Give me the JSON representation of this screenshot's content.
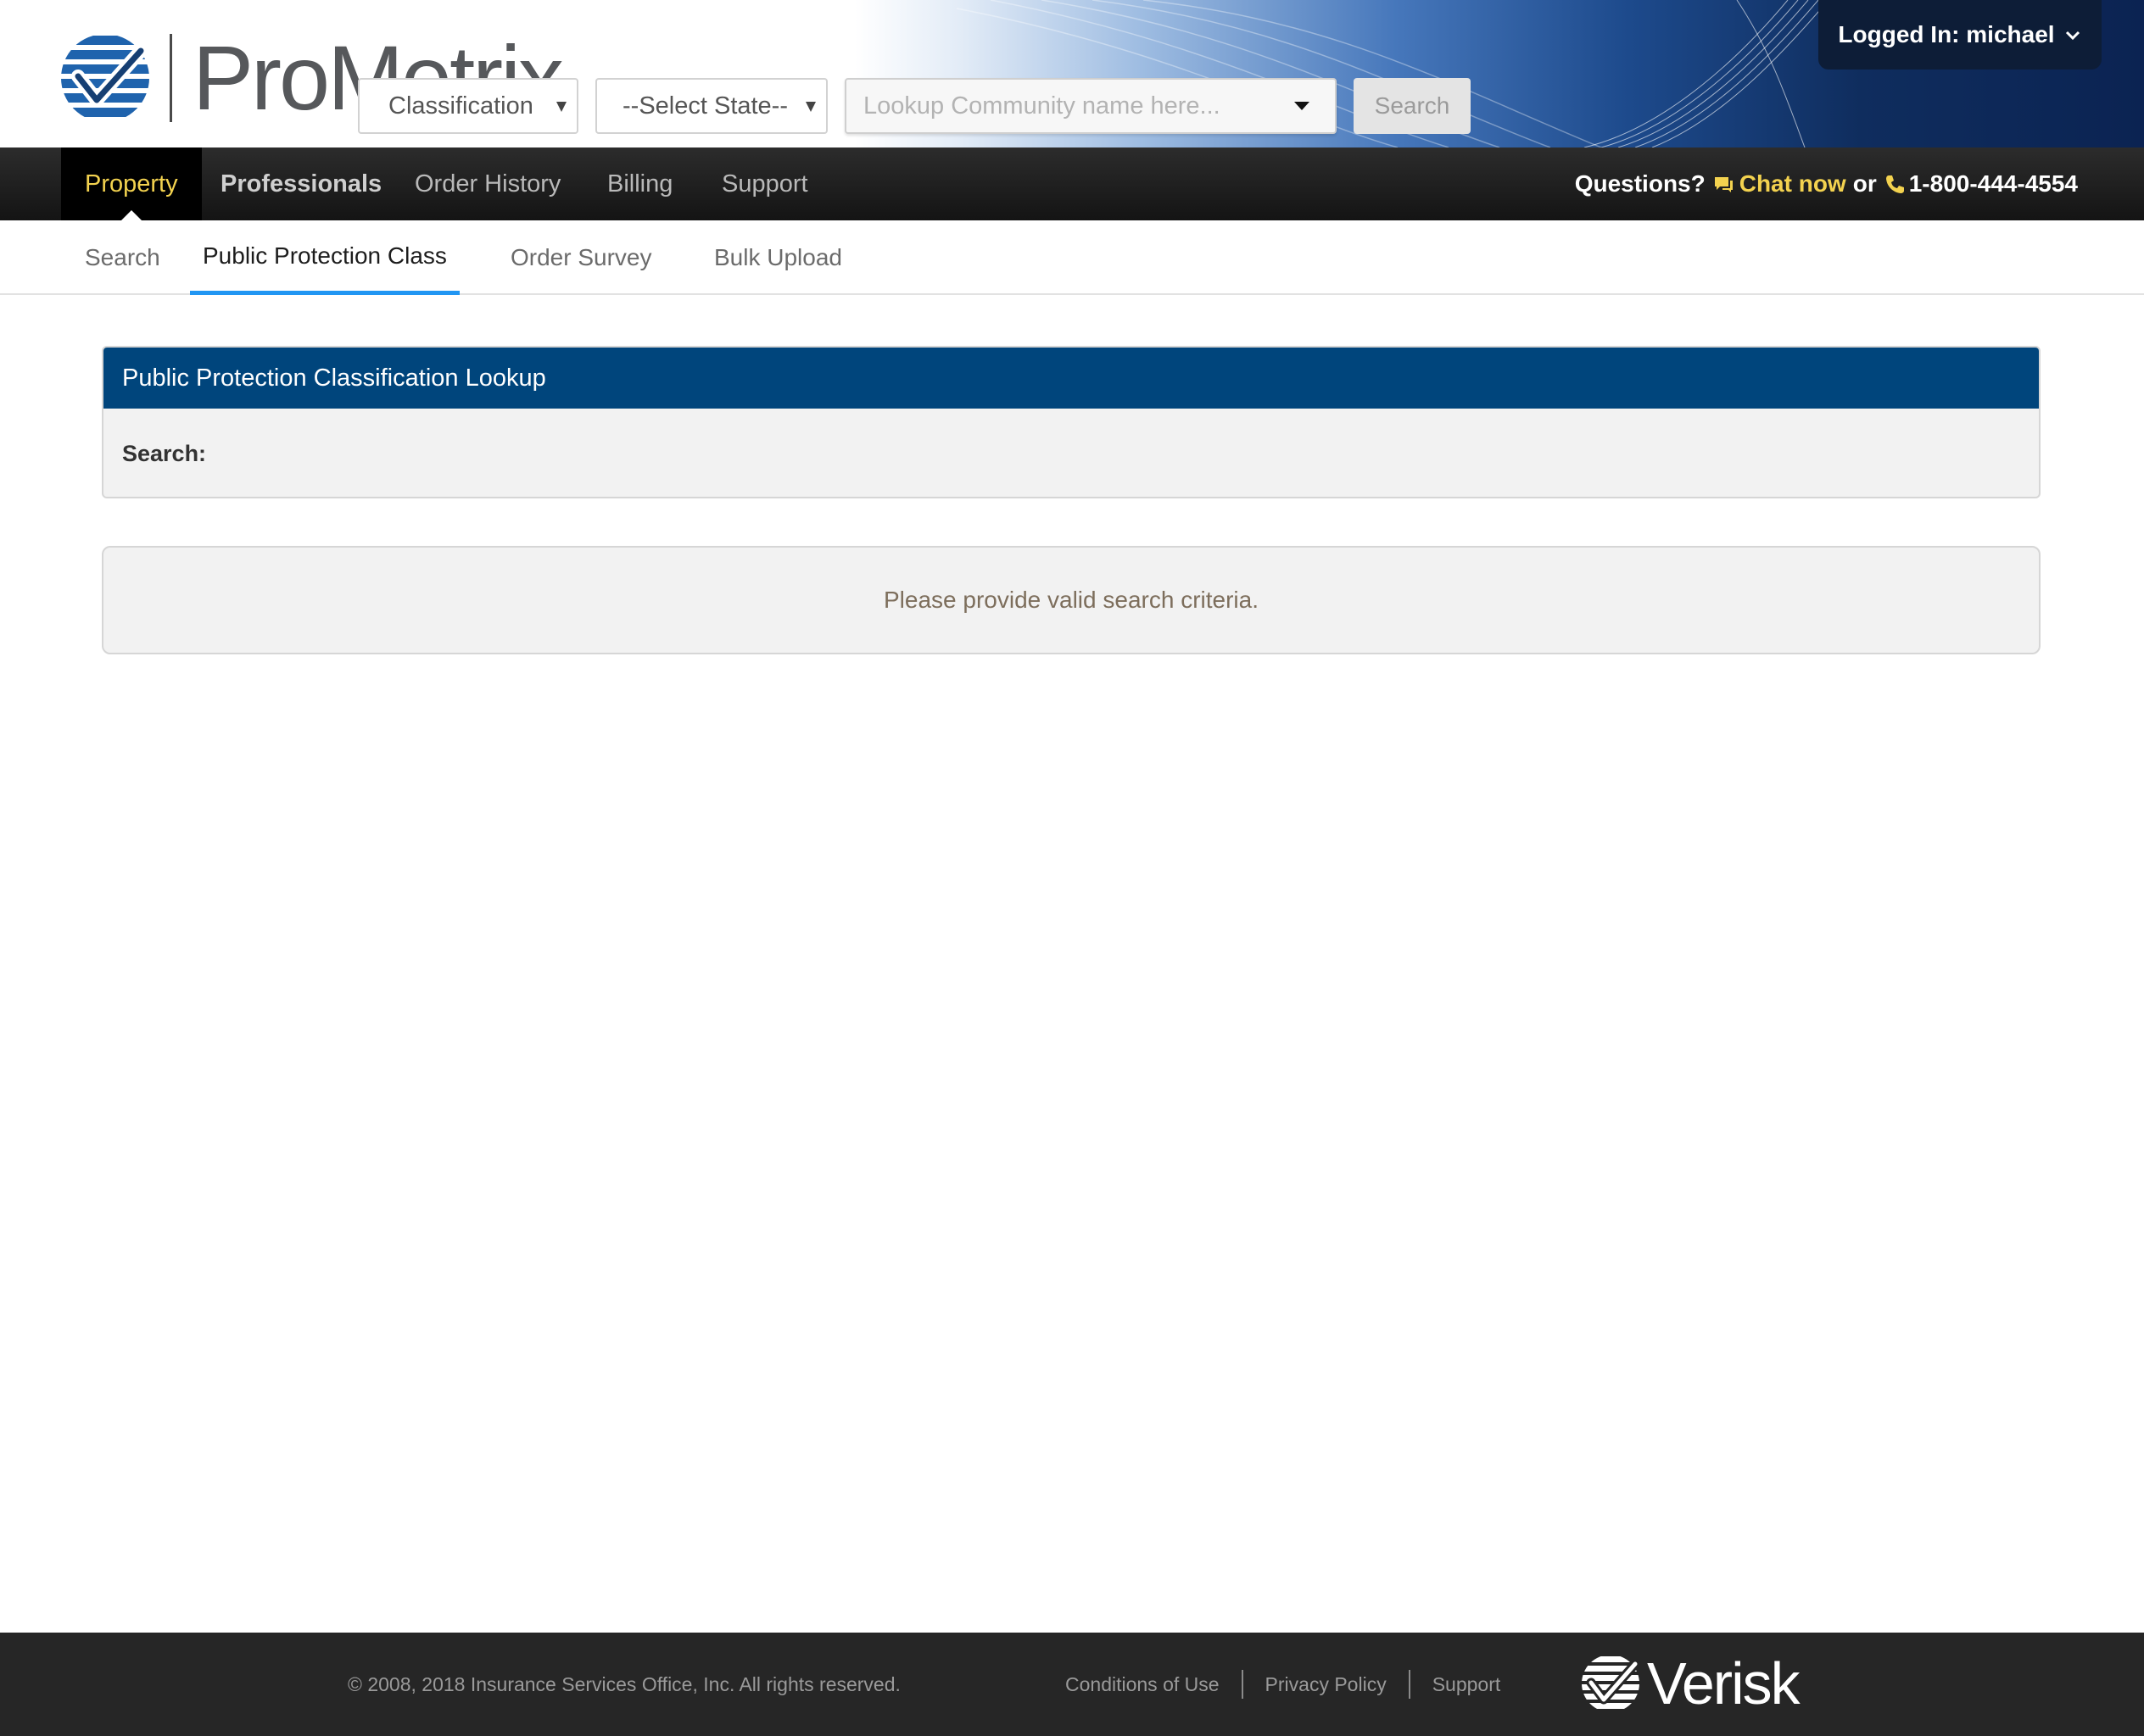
{
  "header": {
    "brand_name": "ProMetrix",
    "user_menu_label": "Logged In: michael"
  },
  "main_nav": {
    "items": [
      {
        "label": "Property"
      },
      {
        "label": "Professionals"
      },
      {
        "label": "Order History"
      },
      {
        "label": "Billing"
      },
      {
        "label": "Support"
      }
    ],
    "active": "Property"
  },
  "help": {
    "prefix": "Questions?",
    "chat_label": "Chat now",
    "connector": "or",
    "phone": "1-800-444-4554"
  },
  "sub_nav": {
    "items": [
      {
        "label": "Search"
      },
      {
        "label": "Public Protection Class"
      },
      {
        "label": "Order Survey"
      },
      {
        "label": "Bulk Upload"
      }
    ],
    "active": "Public Protection Class"
  },
  "lookup": {
    "title": "Public Protection Classification Lookup",
    "search_label": "Search:",
    "type_select_value": "Classification",
    "state_select_value": "--Select State--",
    "community_placeholder": "Lookup Community name here...",
    "search_button": "Search"
  },
  "message": "Please provide valid search criteria.",
  "footer": {
    "copyright": "©  2008, 2018 Insurance Services Office, Inc. All rights reserved.",
    "links": [
      {
        "label": "Conditions of Use"
      },
      {
        "label": "Privacy Policy"
      },
      {
        "label": "Support"
      }
    ],
    "partner_brand": "Verisk"
  },
  "colors": {
    "nav_active_text": "#f3d24f",
    "panel_header_bg": "#00457c",
    "subnav_active_underline": "#2196f3",
    "footer_bg": "#262626"
  },
  "icons": [
    "prometrix-logo-icon",
    "chevron-down-icon",
    "chat-icon",
    "phone-icon",
    "verisk-logo-icon"
  ]
}
